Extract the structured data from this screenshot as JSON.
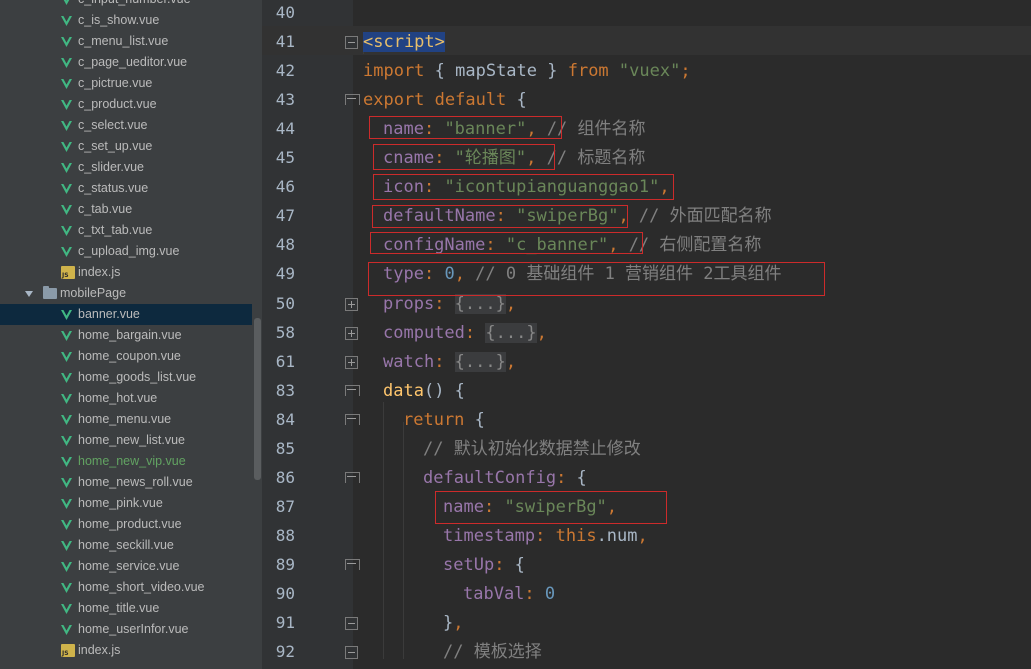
{
  "sidebar": {
    "items": [
      {
        "label": "c_input_number.vue",
        "type": "vue",
        "indent": 1
      },
      {
        "label": "c_is_show.vue",
        "type": "vue",
        "indent": 1
      },
      {
        "label": "c_menu_list.vue",
        "type": "vue",
        "indent": 1
      },
      {
        "label": "c_page_ueditor.vue",
        "type": "vue",
        "indent": 1
      },
      {
        "label": "c_pictrue.vue",
        "type": "vue",
        "indent": 1
      },
      {
        "label": "c_product.vue",
        "type": "vue",
        "indent": 1
      },
      {
        "label": "c_select.vue",
        "type": "vue",
        "indent": 1
      },
      {
        "label": "c_set_up.vue",
        "type": "vue",
        "indent": 1
      },
      {
        "label": "c_slider.vue",
        "type": "vue",
        "indent": 1
      },
      {
        "label": "c_status.vue",
        "type": "vue",
        "indent": 1
      },
      {
        "label": "c_tab.vue",
        "type": "vue",
        "indent": 1
      },
      {
        "label": "c_txt_tab.vue",
        "type": "vue",
        "indent": 1
      },
      {
        "label": "c_upload_img.vue",
        "type": "vue",
        "indent": 1
      },
      {
        "label": "index.js",
        "type": "js",
        "indent": 1
      },
      {
        "label": "mobilePage",
        "type": "folder",
        "indent": 0
      },
      {
        "label": "banner.vue",
        "type": "vue",
        "indent": 1,
        "selected": true
      },
      {
        "label": "home_bargain.vue",
        "type": "vue",
        "indent": 1
      },
      {
        "label": "home_coupon.vue",
        "type": "vue",
        "indent": 1
      },
      {
        "label": "home_goods_list.vue",
        "type": "vue",
        "indent": 1
      },
      {
        "label": "home_hot.vue",
        "type": "vue",
        "indent": 1
      },
      {
        "label": "home_menu.vue",
        "type": "vue",
        "indent": 1
      },
      {
        "label": "home_new_list.vue",
        "type": "vue",
        "indent": 1
      },
      {
        "label": "home_new_vip.vue",
        "type": "vue",
        "indent": 1,
        "vcs": "added"
      },
      {
        "label": "home_news_roll.vue",
        "type": "vue",
        "indent": 1
      },
      {
        "label": "home_pink.vue",
        "type": "vue",
        "indent": 1
      },
      {
        "label": "home_product.vue",
        "type": "vue",
        "indent": 1
      },
      {
        "label": "home_seckill.vue",
        "type": "vue",
        "indent": 1
      },
      {
        "label": "home_service.vue",
        "type": "vue",
        "indent": 1
      },
      {
        "label": "home_short_video.vue",
        "type": "vue",
        "indent": 1
      },
      {
        "label": "home_title.vue",
        "type": "vue",
        "indent": 1
      },
      {
        "label": "home_userInfor.vue",
        "type": "vue",
        "indent": 1
      },
      {
        "label": "index.js",
        "type": "js",
        "indent": 1
      }
    ]
  },
  "editor": {
    "line_numbers": [
      "40",
      "41",
      "42",
      "43",
      "44",
      "45",
      "46",
      "47",
      "48",
      "49",
      "50",
      "58",
      "61",
      "83",
      "84",
      "85",
      "86",
      "87",
      "88",
      "89",
      "90",
      "91",
      "92"
    ],
    "lines": [
      {
        "indent": 0,
        "tokens": []
      },
      {
        "indent": 0,
        "tokens": [
          {
            "c": "t sel",
            "v": "<script>"
          }
        ]
      },
      {
        "indent": 0,
        "tokens": [
          {
            "c": "k",
            "v": "import"
          },
          {
            "c": "",
            "v": " { mapState } "
          },
          {
            "c": "k",
            "v": "from"
          },
          {
            "c": "",
            "v": " "
          },
          {
            "c": "s",
            "v": "\"vuex\""
          },
          {
            "c": "k",
            "v": ";"
          }
        ]
      },
      {
        "indent": 0,
        "tokens": [
          {
            "c": "k",
            "v": "export default"
          },
          {
            "c": "",
            "v": " {"
          }
        ]
      },
      {
        "indent": 1,
        "tokens": [
          {
            "c": "p",
            "v": "name"
          },
          {
            "c": "k",
            "v": ": "
          },
          {
            "c": "s",
            "v": "\"banner\""
          },
          {
            "c": "k",
            "v": ", "
          },
          {
            "c": "c",
            "v": "// 组件名称"
          }
        ]
      },
      {
        "indent": 1,
        "tokens": [
          {
            "c": "p",
            "v": "cname"
          },
          {
            "c": "k",
            "v": ": "
          },
          {
            "c": "s",
            "v": "\"轮播图\""
          },
          {
            "c": "k",
            "v": ", "
          },
          {
            "c": "c",
            "v": "// 标题名称"
          }
        ]
      },
      {
        "indent": 1,
        "tokens": [
          {
            "c": "p",
            "v": "icon"
          },
          {
            "c": "k",
            "v": ": "
          },
          {
            "c": "s",
            "v": "\"icontupianguanggao1\""
          },
          {
            "c": "k",
            "v": ","
          }
        ]
      },
      {
        "indent": 1,
        "tokens": [
          {
            "c": "p",
            "v": "defaultName"
          },
          {
            "c": "k",
            "v": ": "
          },
          {
            "c": "s",
            "v": "\"swiperBg\""
          },
          {
            "c": "k",
            "v": ", "
          },
          {
            "c": "c",
            "v": "// 外面匹配名称"
          }
        ]
      },
      {
        "indent": 1,
        "tokens": [
          {
            "c": "p",
            "v": "configName"
          },
          {
            "c": "k",
            "v": ": "
          },
          {
            "c": "s",
            "v": "\"c_banner\""
          },
          {
            "c": "k",
            "v": ", "
          },
          {
            "c": "c",
            "v": "// 右侧配置名称"
          }
        ]
      },
      {
        "indent": 1,
        "tokens": [
          {
            "c": "p",
            "v": "type"
          },
          {
            "c": "k",
            "v": ": "
          },
          {
            "c": "n",
            "v": "0"
          },
          {
            "c": "k",
            "v": ", "
          },
          {
            "c": "c",
            "v": "// 0 基础组件 1 营销组件 2工具组件"
          }
        ]
      },
      {
        "indent": 1,
        "tokens": [
          {
            "c": "p",
            "v": "props"
          },
          {
            "c": "k",
            "v": ": "
          },
          {
            "c": "fold-text",
            "v": "{...}"
          },
          {
            "c": "k",
            "v": ","
          }
        ]
      },
      {
        "indent": 1,
        "tokens": [
          {
            "c": "p",
            "v": "computed"
          },
          {
            "c": "k",
            "v": ": "
          },
          {
            "c": "fold-text",
            "v": "{...}"
          },
          {
            "c": "k",
            "v": ","
          }
        ]
      },
      {
        "indent": 1,
        "tokens": [
          {
            "c": "p",
            "v": "watch"
          },
          {
            "c": "k",
            "v": ": "
          },
          {
            "c": "fold-text",
            "v": "{...}"
          },
          {
            "c": "k",
            "v": ","
          }
        ]
      },
      {
        "indent": 1,
        "tokens": [
          {
            "c": "f",
            "v": "data"
          },
          {
            "c": "",
            "v": "() {"
          }
        ]
      },
      {
        "indent": 2,
        "tokens": [
          {
            "c": "k",
            "v": "return"
          },
          {
            "c": "",
            "v": " {"
          }
        ]
      },
      {
        "indent": 3,
        "tokens": [
          {
            "c": "c",
            "v": "// 默认初始化数据禁止修改"
          }
        ]
      },
      {
        "indent": 3,
        "tokens": [
          {
            "c": "p",
            "v": "defaultConfig"
          },
          {
            "c": "k",
            "v": ": "
          },
          {
            "c": "",
            "v": "{"
          }
        ]
      },
      {
        "indent": 4,
        "tokens": [
          {
            "c": "p",
            "v": "name"
          },
          {
            "c": "k",
            "v": ": "
          },
          {
            "c": "s",
            "v": "\"swiperBg\""
          },
          {
            "c": "k",
            "v": ","
          }
        ]
      },
      {
        "indent": 4,
        "tokens": [
          {
            "c": "p",
            "v": "timestamp"
          },
          {
            "c": "k",
            "v": ": "
          },
          {
            "c": "k",
            "v": "this"
          },
          {
            "c": "",
            "v": ".num"
          },
          {
            "c": "k",
            "v": ","
          }
        ]
      },
      {
        "indent": 4,
        "tokens": [
          {
            "c": "p",
            "v": "setUp"
          },
          {
            "c": "k",
            "v": ": "
          },
          {
            "c": "",
            "v": "{"
          }
        ]
      },
      {
        "indent": 5,
        "tokens": [
          {
            "c": "p",
            "v": "tabVal"
          },
          {
            "c": "k",
            "v": ": "
          },
          {
            "c": "n",
            "v": "0"
          }
        ]
      },
      {
        "indent": 4,
        "tokens": [
          {
            "c": "",
            "v": "}"
          },
          {
            "c": "k",
            "v": ","
          }
        ]
      },
      {
        "indent": 4,
        "tokens": [
          {
            "c": "c",
            "v": "// 模板选择"
          }
        ]
      }
    ]
  },
  "colors": {
    "keyword": "#cc7832",
    "string": "#6a8759",
    "property": "#9876aa",
    "number": "#6897bb",
    "comment": "#808080",
    "annotation_box": "#cc2b2b"
  }
}
